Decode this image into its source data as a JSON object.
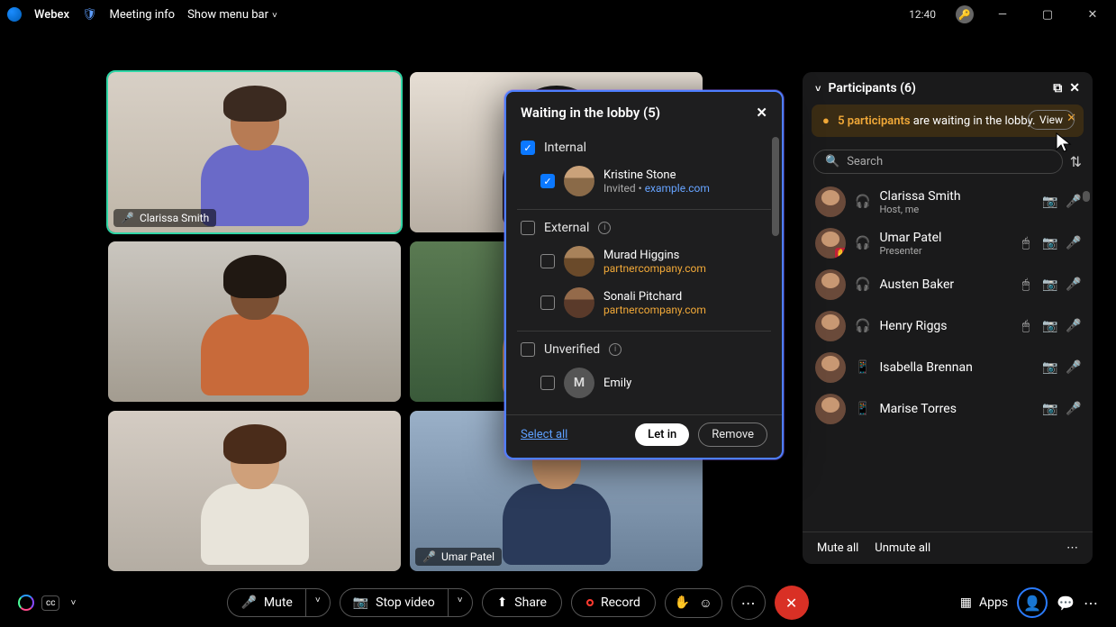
{
  "app": {
    "name": "Webex",
    "meeting_info": "Meeting info",
    "menu_bar": "Show menu bar",
    "clock": "12:40"
  },
  "lobby": {
    "title": "Waiting in the lobby (5)",
    "sections": {
      "internal": {
        "label": "Internal",
        "people": [
          {
            "name": "Kristine Stone",
            "invited_prefix": "Invited • ",
            "domain": "example.com"
          }
        ]
      },
      "external": {
        "label": "External",
        "people": [
          {
            "name": "Murad Higgins",
            "domain": "partnercompany.com"
          },
          {
            "name": "Sonali Pitchard",
            "domain": "partnercompany.com"
          }
        ]
      },
      "unverified": {
        "label": "Unverified",
        "people": [
          {
            "name": "Emily",
            "initial": "M"
          }
        ]
      }
    },
    "select_all": "Select all",
    "let_in": "Let in",
    "remove": "Remove"
  },
  "participants": {
    "title": "Participants (6)",
    "banner_bold": "5 participants",
    "banner_rest": " are waiting in the lobby.",
    "view": "View",
    "search_placeholder": "Search",
    "list": [
      {
        "name": "Clarissa Smith",
        "sub": "Host, me",
        "headset": true,
        "cam": true,
        "mic": "green"
      },
      {
        "name": "Umar Patel",
        "sub": "Presenter",
        "headset": true,
        "raise": true,
        "mouse": true,
        "cam": true,
        "mic": "green"
      },
      {
        "name": "Austen Baker",
        "headset": true,
        "mouse": true,
        "cam": true,
        "mic": "red"
      },
      {
        "name": "Henry Riggs",
        "headset": true,
        "mouse": true,
        "cam": true,
        "mic": "red"
      },
      {
        "name": "Isabella Brennan",
        "mobile": true,
        "cam": true,
        "mic": "red"
      },
      {
        "name": "Marise Torres",
        "mobile": true,
        "cam": true,
        "mic": "red"
      }
    ],
    "mute_all": "Mute all",
    "unmute_all": "Unmute all"
  },
  "tiles": {
    "clarissa": "Clarissa Smith",
    "umar": "Umar Patel"
  },
  "controls": {
    "mute": "Mute",
    "stop_video": "Stop video",
    "share": "Share",
    "record": "Record",
    "apps": "Apps"
  }
}
